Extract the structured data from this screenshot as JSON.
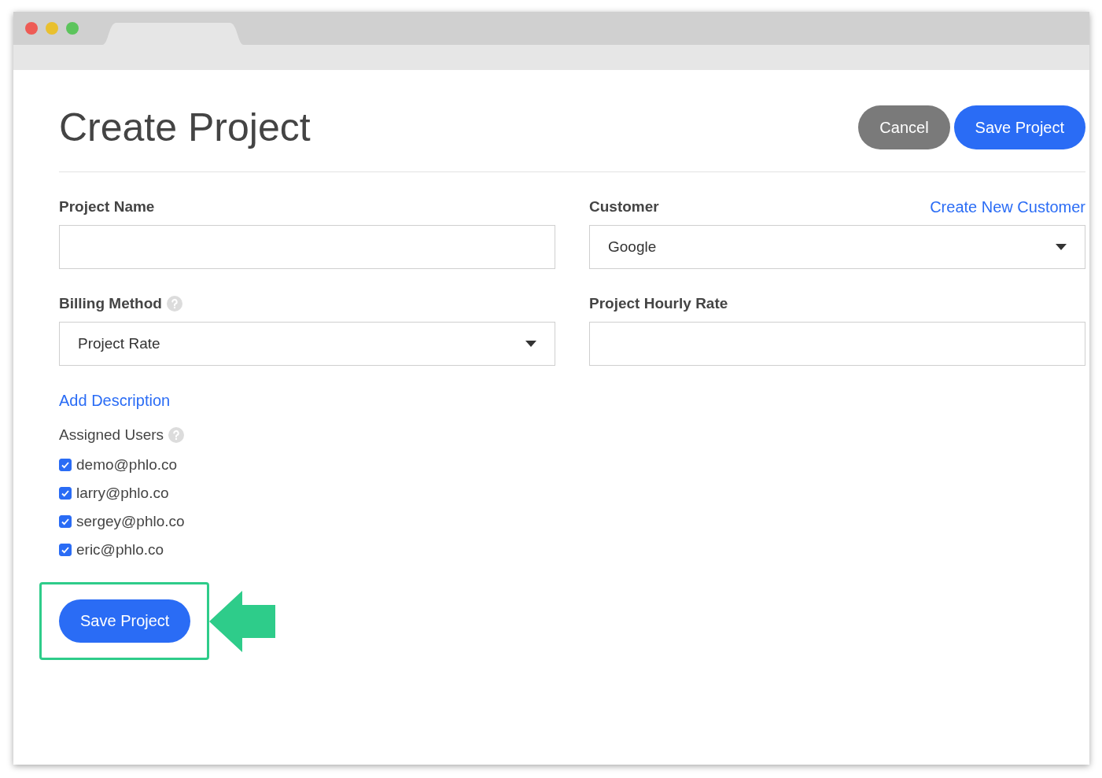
{
  "title": "Create Project",
  "header_buttons": [
    {
      "label": "Cancel",
      "kind": "secondary"
    },
    {
      "label": "Save Project",
      "kind": "primary"
    }
  ],
  "fields": [
    {
      "label": "Project Name",
      "kind": "text"
    },
    {
      "label": "Customer",
      "kind": "select",
      "value": "Google",
      "link": "Create New Customer"
    },
    {
      "label": "Billing Method",
      "kind": "select",
      "value": "Project Rate",
      "help": true
    },
    {
      "label": "Project Hourly Rate",
      "kind": "text"
    }
  ],
  "add_description_link": "Add Description",
  "assigned_users": {
    "label": "Assigned Users",
    "help": true,
    "users": [
      {
        "email": "demo@phlo.co",
        "checked": true
      },
      {
        "email": "larry@phlo.co",
        "checked": true
      },
      {
        "email": "sergey@phlo.co",
        "checked": true
      },
      {
        "email": "eric@phlo.co",
        "checked": true
      }
    ]
  },
  "footer": {
    "button": "Save Project",
    "highlighted": true
  }
}
